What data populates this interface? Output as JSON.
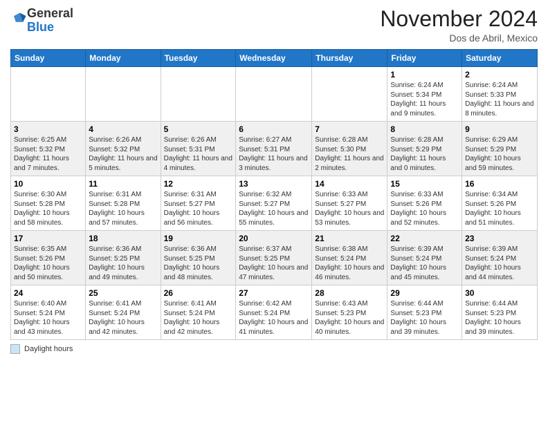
{
  "logo": {
    "general": "General",
    "blue": "Blue"
  },
  "header": {
    "month": "November 2024",
    "location": "Dos de Abril, Mexico"
  },
  "weekdays": [
    "Sunday",
    "Monday",
    "Tuesday",
    "Wednesday",
    "Thursday",
    "Friday",
    "Saturday"
  ],
  "weeks": [
    [
      {
        "day": "",
        "info": ""
      },
      {
        "day": "",
        "info": ""
      },
      {
        "day": "",
        "info": ""
      },
      {
        "day": "",
        "info": ""
      },
      {
        "day": "",
        "info": ""
      },
      {
        "day": "1",
        "info": "Sunrise: 6:24 AM\nSunset: 5:34 PM\nDaylight: 11 hours and 9 minutes."
      },
      {
        "day": "2",
        "info": "Sunrise: 6:24 AM\nSunset: 5:33 PM\nDaylight: 11 hours and 8 minutes."
      }
    ],
    [
      {
        "day": "3",
        "info": "Sunrise: 6:25 AM\nSunset: 5:32 PM\nDaylight: 11 hours and 7 minutes."
      },
      {
        "day": "4",
        "info": "Sunrise: 6:26 AM\nSunset: 5:32 PM\nDaylight: 11 hours and 5 minutes."
      },
      {
        "day": "5",
        "info": "Sunrise: 6:26 AM\nSunset: 5:31 PM\nDaylight: 11 hours and 4 minutes."
      },
      {
        "day": "6",
        "info": "Sunrise: 6:27 AM\nSunset: 5:31 PM\nDaylight: 11 hours and 3 minutes."
      },
      {
        "day": "7",
        "info": "Sunrise: 6:28 AM\nSunset: 5:30 PM\nDaylight: 11 hours and 2 minutes."
      },
      {
        "day": "8",
        "info": "Sunrise: 6:28 AM\nSunset: 5:29 PM\nDaylight: 11 hours and 0 minutes."
      },
      {
        "day": "9",
        "info": "Sunrise: 6:29 AM\nSunset: 5:29 PM\nDaylight: 10 hours and 59 minutes."
      }
    ],
    [
      {
        "day": "10",
        "info": "Sunrise: 6:30 AM\nSunset: 5:28 PM\nDaylight: 10 hours and 58 minutes."
      },
      {
        "day": "11",
        "info": "Sunrise: 6:31 AM\nSunset: 5:28 PM\nDaylight: 10 hours and 57 minutes."
      },
      {
        "day": "12",
        "info": "Sunrise: 6:31 AM\nSunset: 5:27 PM\nDaylight: 10 hours and 56 minutes."
      },
      {
        "day": "13",
        "info": "Sunrise: 6:32 AM\nSunset: 5:27 PM\nDaylight: 10 hours and 55 minutes."
      },
      {
        "day": "14",
        "info": "Sunrise: 6:33 AM\nSunset: 5:27 PM\nDaylight: 10 hours and 53 minutes."
      },
      {
        "day": "15",
        "info": "Sunrise: 6:33 AM\nSunset: 5:26 PM\nDaylight: 10 hours and 52 minutes."
      },
      {
        "day": "16",
        "info": "Sunrise: 6:34 AM\nSunset: 5:26 PM\nDaylight: 10 hours and 51 minutes."
      }
    ],
    [
      {
        "day": "17",
        "info": "Sunrise: 6:35 AM\nSunset: 5:26 PM\nDaylight: 10 hours and 50 minutes."
      },
      {
        "day": "18",
        "info": "Sunrise: 6:36 AM\nSunset: 5:25 PM\nDaylight: 10 hours and 49 minutes."
      },
      {
        "day": "19",
        "info": "Sunrise: 6:36 AM\nSunset: 5:25 PM\nDaylight: 10 hours and 48 minutes."
      },
      {
        "day": "20",
        "info": "Sunrise: 6:37 AM\nSunset: 5:25 PM\nDaylight: 10 hours and 47 minutes."
      },
      {
        "day": "21",
        "info": "Sunrise: 6:38 AM\nSunset: 5:24 PM\nDaylight: 10 hours and 46 minutes."
      },
      {
        "day": "22",
        "info": "Sunrise: 6:39 AM\nSunset: 5:24 PM\nDaylight: 10 hours and 45 minutes."
      },
      {
        "day": "23",
        "info": "Sunrise: 6:39 AM\nSunset: 5:24 PM\nDaylight: 10 hours and 44 minutes."
      }
    ],
    [
      {
        "day": "24",
        "info": "Sunrise: 6:40 AM\nSunset: 5:24 PM\nDaylight: 10 hours and 43 minutes."
      },
      {
        "day": "25",
        "info": "Sunrise: 6:41 AM\nSunset: 5:24 PM\nDaylight: 10 hours and 42 minutes."
      },
      {
        "day": "26",
        "info": "Sunrise: 6:41 AM\nSunset: 5:24 PM\nDaylight: 10 hours and 42 minutes."
      },
      {
        "day": "27",
        "info": "Sunrise: 6:42 AM\nSunset: 5:24 PM\nDaylight: 10 hours and 41 minutes."
      },
      {
        "day": "28",
        "info": "Sunrise: 6:43 AM\nSunset: 5:23 PM\nDaylight: 10 hours and 40 minutes."
      },
      {
        "day": "29",
        "info": "Sunrise: 6:44 AM\nSunset: 5:23 PM\nDaylight: 10 hours and 39 minutes."
      },
      {
        "day": "30",
        "info": "Sunrise: 6:44 AM\nSunset: 5:23 PM\nDaylight: 10 hours and 39 minutes."
      }
    ]
  ],
  "legend": {
    "box_color": "#c8e6fa",
    "text": "Daylight hours"
  }
}
